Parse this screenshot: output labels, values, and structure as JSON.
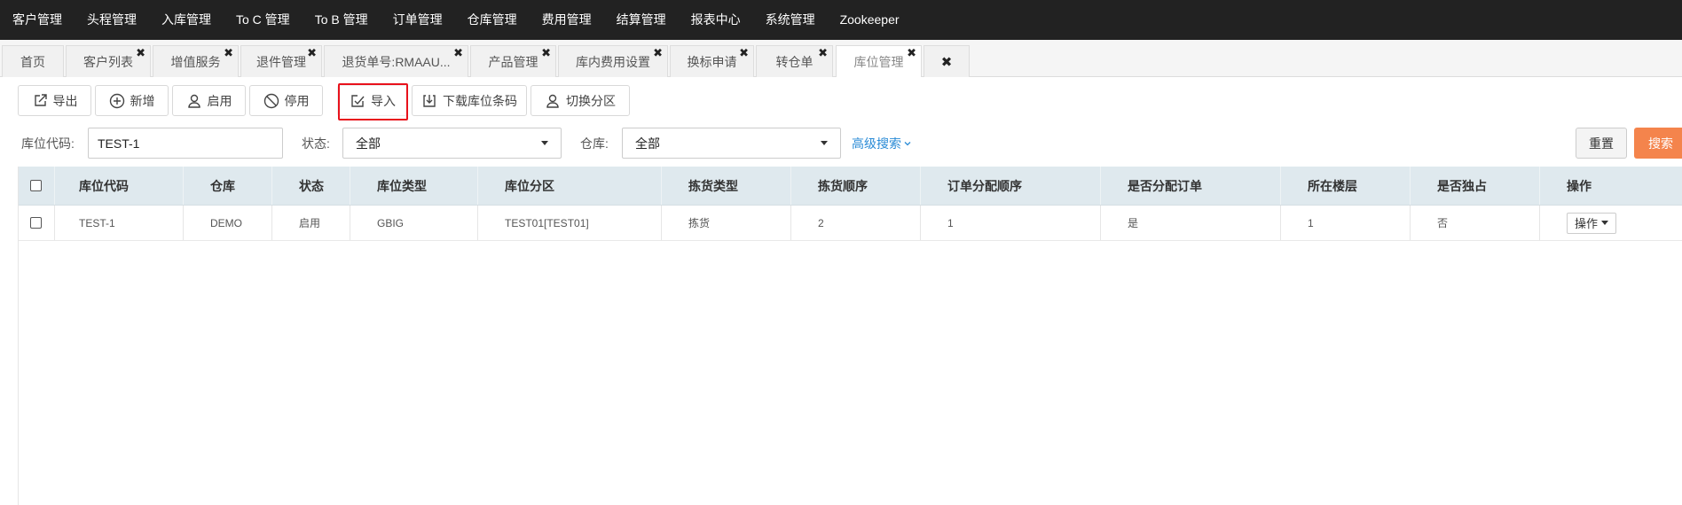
{
  "topnav": {
    "items": [
      "客户管理",
      "头程管理",
      "入库管理",
      "To C 管理",
      "To B 管理",
      "订单管理",
      "仓库管理",
      "费用管理",
      "结算管理",
      "报表中心",
      "系统管理",
      "Zookeeper"
    ]
  },
  "tabs": {
    "items": [
      "首页",
      "客户列表",
      "增值服务",
      "退件管理",
      "退货单号:RMAAU...",
      "产品管理",
      "库内费用设置",
      "换标申请",
      "转仓单",
      "库位管理"
    ],
    "active": "库位管理",
    "close_icon": "close-icon",
    "close_all_icon": "close-all-icon"
  },
  "toolbar": {
    "export_label": "导出",
    "add_label": "新增",
    "enable_label": "启用",
    "disable_label": "停用",
    "import_label": "导入",
    "download_barcode_label": "下载库位条码",
    "switch_zone_label": "切换分区",
    "highlight_color": "#e8111b"
  },
  "search": {
    "location_code_label": "库位代码:",
    "location_code_value": "TEST-1",
    "status_label": "状态:",
    "status_value": "全部",
    "warehouse_label": "仓库:",
    "warehouse_value": "全部",
    "advanced_label": "高级搜索",
    "reset_label": "重置",
    "search_label": "搜索",
    "search_color": "#f4844c",
    "link_color": "#2a8bd6"
  },
  "table": {
    "columns": [
      "库位代码",
      "仓库",
      "状态",
      "库位类型",
      "库位分区",
      "拣货类型",
      "拣货顺序",
      "订单分配顺序",
      "是否分配订单",
      "所在楼层",
      "是否独占",
      "操作"
    ],
    "rows": [
      {
        "code": "TEST-1",
        "warehouse": "DEMO",
        "status": "启用",
        "type": "GBIG",
        "zone": "TEST01[TEST01]",
        "pick_type": "拣货",
        "pick_order": "2",
        "alloc_order": "1",
        "allocate": "是",
        "floor": "1",
        "exclusive": "否",
        "action_label": "操作"
      }
    ],
    "header_bg": "#dfe9ee"
  }
}
